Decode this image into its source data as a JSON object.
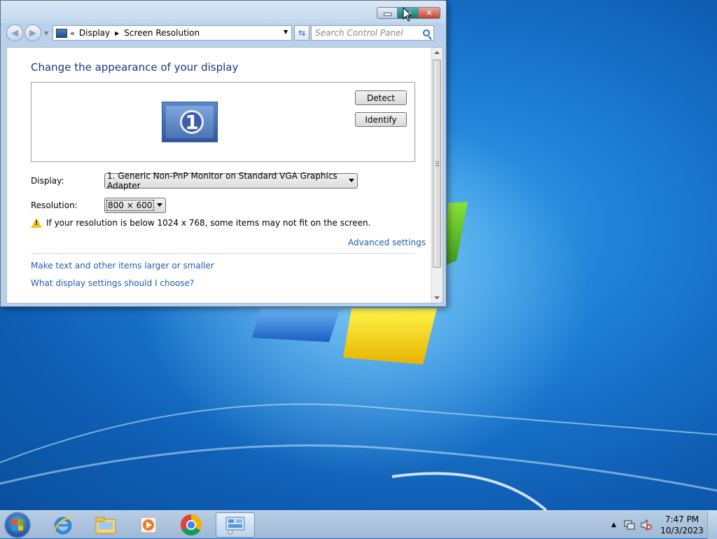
{
  "window": {
    "address": {
      "overflow": "«",
      "segments": [
        "Display",
        "Screen Resolution"
      ]
    },
    "search_placeholder": "Search Control Panel",
    "title": "Change the appearance of your display",
    "monitor_number": "1",
    "buttons": {
      "detect": "Detect",
      "identify": "Identify"
    },
    "display_label": "Display:",
    "display_value": "1. Generic Non-PnP Monitor on Standard VGA Graphics Adapter",
    "resolution_label": "Resolution:",
    "resolution_value": "800 × 600",
    "warning": "If your resolution is below 1024 x 768, some items may not fit on the screen.",
    "links": {
      "advanced": "Advanced settings",
      "larger": "Make text and other items larger or smaller",
      "choose": "What display settings should I choose?"
    }
  },
  "taskbar": {
    "apps": [
      "internet-explorer",
      "file-explorer",
      "media-player",
      "chrome",
      "control-panel"
    ],
    "active_app": "control-panel",
    "time": "7:47 PM",
    "date": "10/3/2023"
  },
  "colors": {
    "title_text": "#1e3287",
    "link_text": "#1e5fb3",
    "warning": "#f5c518"
  }
}
